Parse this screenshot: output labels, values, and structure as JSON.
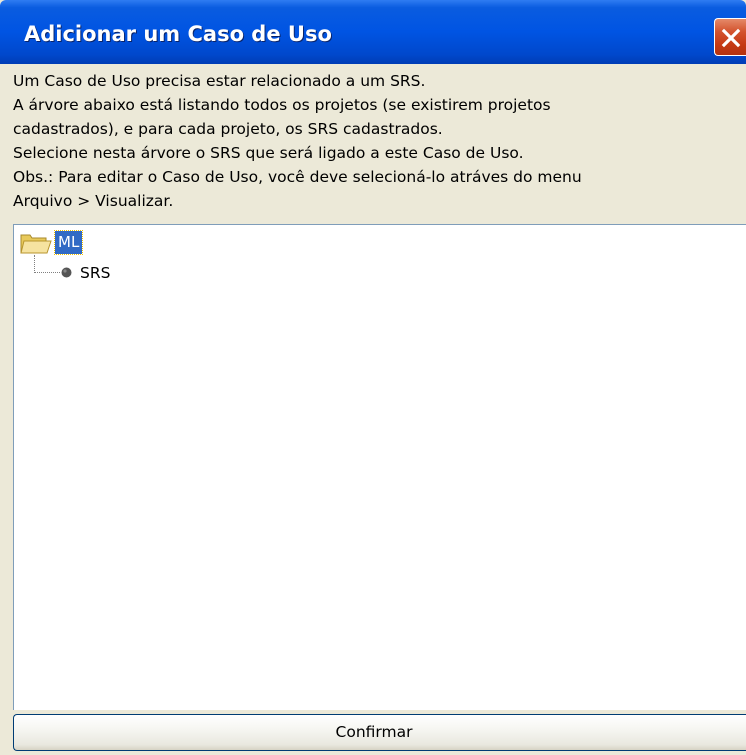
{
  "window": {
    "title": "Adicionar um Caso de Uso",
    "close_icon": "close-icon"
  },
  "description": {
    "lines": [
      "Um Caso de Uso precisa estar relacionado a um SRS.",
      "A árvore abaixo está listando todos os projetos (se existirem projetos",
      "cadastrados), e para cada projeto, os SRS cadastrados.",
      "Selecione nesta árvore o SRS que será ligado a este Caso de Uso.",
      "Obs.: Para editar o Caso de Uso, você deve selecioná-lo atráves do menu",
      "Arquivo > Visualizar."
    ]
  },
  "tree": {
    "root": {
      "label": "ML",
      "icon": "folder-open-icon",
      "selected": true,
      "children": [
        {
          "label": "SRS",
          "icon": "leaf-dot-icon"
        }
      ]
    }
  },
  "footer": {
    "confirm_label": "Confirmar"
  },
  "colors": {
    "titlebar": "#0054E3",
    "dialog_background": "#ECE9D8",
    "selection": "#316AC5",
    "close_button": "#C63A14"
  }
}
